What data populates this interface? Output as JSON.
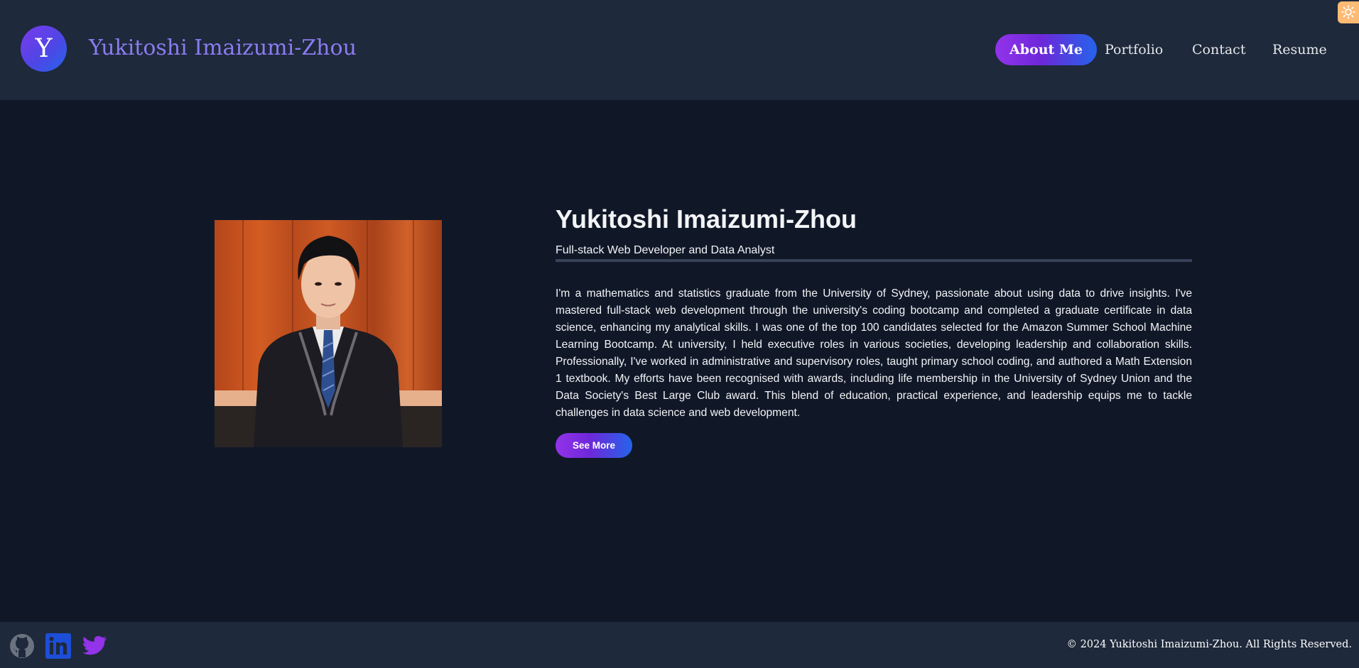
{
  "header": {
    "logo_letter": "Y",
    "site_title": "Yukitoshi Imaizumi-Zhou",
    "nav": [
      {
        "label": "About Me",
        "active": true
      },
      {
        "label": "Portfolio",
        "active": false
      },
      {
        "label": "Contact",
        "active": false
      },
      {
        "label": "Resume",
        "active": false
      }
    ],
    "theme_toggle_icon": "sun-icon"
  },
  "main": {
    "photo_icon": "profile-photo",
    "name": "Yukitoshi Imaizumi-Zhou",
    "tagline": "Full-stack Web Developer and Data Analyst",
    "bio": "I'm a mathematics and statistics graduate from the University of Sydney, passionate about using data to drive insights. I've mastered full-stack web development through the university's coding bootcamp and completed a graduate certificate in data science, enhancing my analytical skills. I was one of the top 100 candidates selected for the Amazon Summer School Machine Learning Bootcamp. At university, I held executive roles in various societies, developing leadership and collaboration skills. Professionally, I've worked in administrative and supervisory roles, taught primary school coding, and authored a Math Extension 1 textbook. My efforts have been recognised with awards, including life membership in the University of Sydney Union and the Data Society's Best Large Club award. This blend of education, practical experience, and leadership equips me to tackle challenges in data science and web development.",
    "see_more_label": "See More"
  },
  "footer": {
    "social_icons": [
      "github-icon",
      "linkedin-icon",
      "twitter-icon"
    ],
    "copyright": "© 2024 Yukitoshi Imaizumi-Zhou. All Rights Reserved."
  },
  "colors": {
    "page_bg": "#101828",
    "header_bg": "#1e293b",
    "accent_purple": "#9333ea",
    "accent_blue": "#2563eb",
    "site_title": "#8b7cf0",
    "theme_toggle": "#fdba74",
    "github": "#6b7280",
    "linkedin": "#1d4ed8",
    "twitter": "#9333ea"
  }
}
